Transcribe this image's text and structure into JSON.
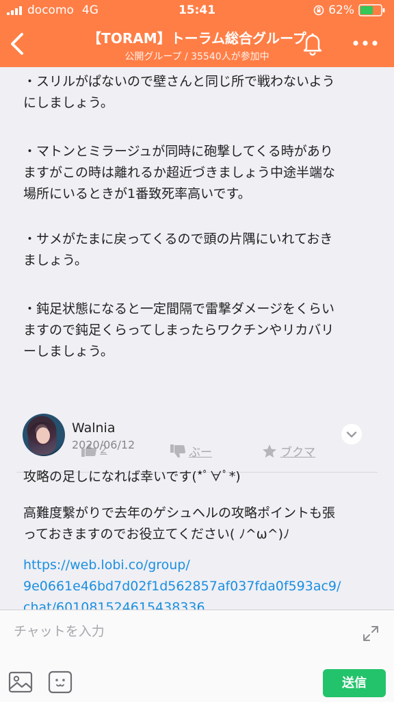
{
  "status_bar": {
    "carrier": "docomo",
    "network": "4G",
    "time": "15:41",
    "battery_percent": "62%",
    "battery_level": 0.62,
    "battery_color": "#34c759"
  },
  "header": {
    "title": "【TORAM】トーラム総合グループ",
    "subtitle": "公開グループ / 35540人が参加中",
    "bg_color": "#ff7e46"
  },
  "messages": {
    "paragraphs": [
      [
        "・スリルがぱないので壁さんと同じ所で戦わないよう",
        "にしましょう。"
      ],
      [
        "・マトンとミラージュが同時に砲撃してくる時があり",
        "ますがこの時は離れるか超近づきましょう中途半端な",
        "場所にいるときが1番致死率高いです。"
      ],
      [
        "・サメがたまに戻ってくるので頭の片隅にいれておき",
        "ましょう。"
      ],
      [
        "・鈍足状態になると一定間隔で雷撃ダメージをくらい",
        "ますので鈍足くらってしまったらワクチンやリカバリ",
        "ーしましょう。"
      ]
    ]
  },
  "reactions": {
    "like_count": "2",
    "boo_label": "ぶー",
    "bookmark_label": "ブクマ"
  },
  "post": {
    "author": "Walnia",
    "date": "2020/06/12",
    "line1": "攻略の足しになれば幸いです(*ﾟ∀ﾟ*)",
    "line2a": "高難度繋がりで去年のゲシュヘルの攻略ポイントも張",
    "line2b": "っておきますのでお役立てください( ﾉ^ω^)ﾉ",
    "link_lines": [
      "https://web.lobi.co/group/",
      "9e0661e46bd7d02f1d562857af037fda0f593ac9/",
      "chat/601081524615438336"
    ]
  },
  "composer": {
    "placeholder": "チャットを入力",
    "send_label": "送信",
    "send_color": "#23c36b"
  }
}
